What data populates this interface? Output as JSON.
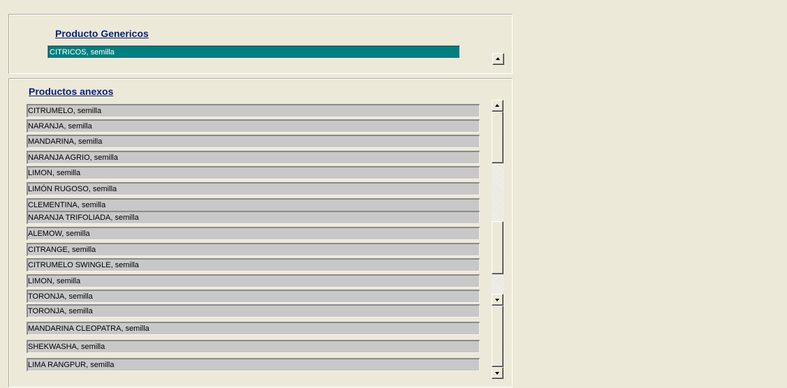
{
  "generic": {
    "title": "Producto Genericos",
    "selected_value": "CITRICOS, semilla"
  },
  "annex": {
    "title": "Productos anexos",
    "items": [
      "CITRUMELO, semilla",
      "NARANJA, semilla",
      "MANDARINA, semilla",
      "NARANJA AGRIO, semilla",
      "LIMON, semilla",
      "LIMÓN RUGOSO, semilla",
      "CLEMENTINA, semilla",
      "NARANJA TRIFOLIADA, semilla",
      "ALEMOW, semilla",
      "CITRANGE, semilla",
      "CITRUMELO SWINGLE, semilla",
      "LIMON,  semilla",
      "TORONJA, semilla",
      "TORONJA, semilla",
      "MANDARINA CLEOPATRA, semilla",
      "SHEKWASHA, semilla",
      "LIMA RANGPUR, semilla"
    ]
  },
  "icons": {
    "up": "arrow-up-icon",
    "down": "arrow-down-icon"
  }
}
